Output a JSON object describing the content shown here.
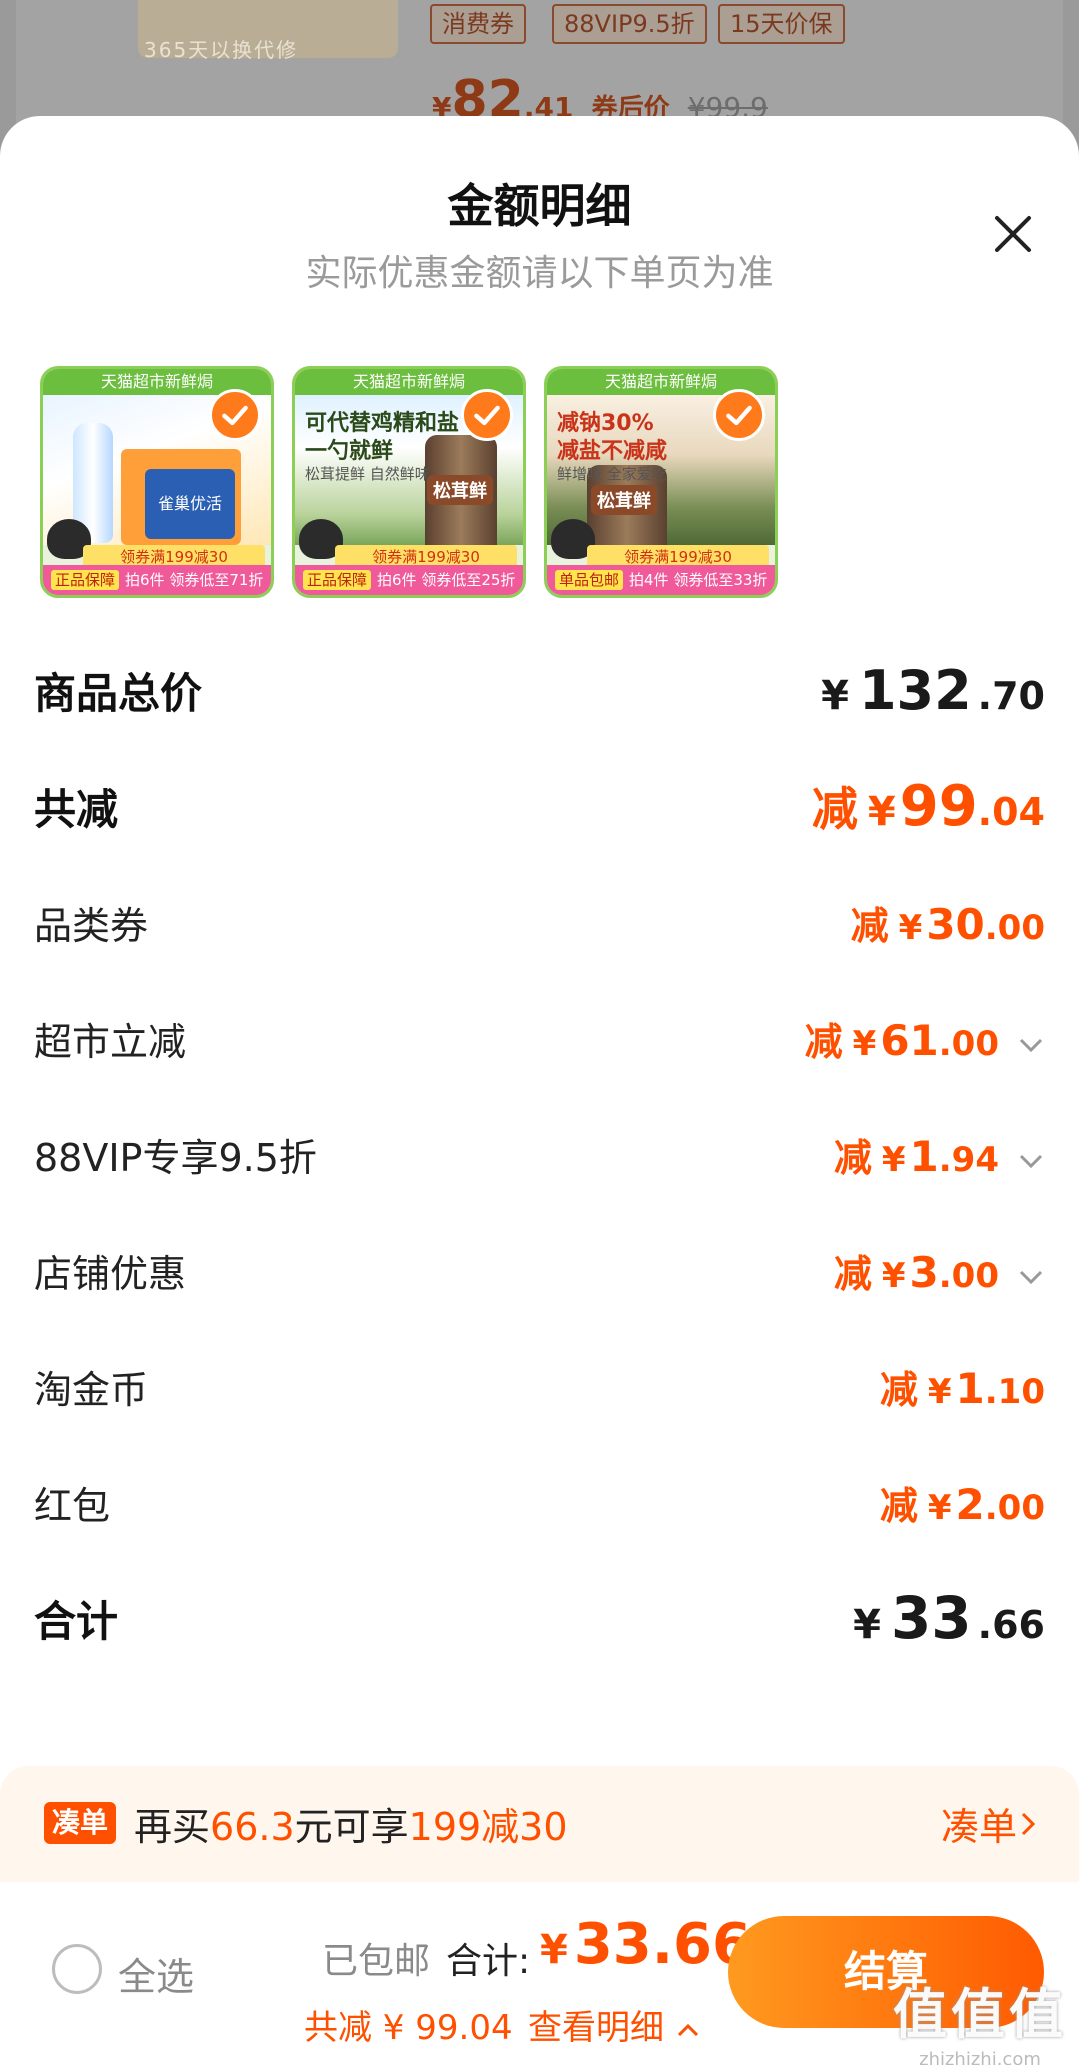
{
  "background": {
    "thumb_text": "365天以换代修",
    "tags": [
      "消费券",
      "88VIP9.5折",
      "15天价保"
    ],
    "price_currency": "¥",
    "price_int": "82",
    "price_dec": ".41",
    "price_after_label": "券后价",
    "price_orig": "¥99.9"
  },
  "sheet": {
    "title": "金额明细",
    "subtitle": "实际优惠金额请以下单页为准",
    "close_icon": "close-icon"
  },
  "products": [
    {
      "top": "天猫超市新鲜焗",
      "coupon": "领券满199减30",
      "badge": "正品保障",
      "bottom": "拍6件 领券低至71折",
      "text1": "",
      "text2": "",
      "brand": "雀巢优活"
    },
    {
      "top": "天猫超市新鲜焗",
      "coupon": "领券满199减30",
      "badge": "正品保障",
      "bottom": "拍6件 领券低至25折",
      "text1": "可代替鸡精和盐",
      "text2": "一勺就鲜",
      "text3": "松茸提鲜 自然鲜味",
      "brand": "松茸鲜"
    },
    {
      "top": "天猫超市新鲜焗",
      "coupon": "领券满199减30",
      "badge": "单品包邮",
      "bottom": "拍4件 领券低至33折",
      "text1": "减钠30%",
      "text2": "减盐不减咸",
      "text3": "鲜增味 全家爱吃",
      "brand": "松茸鲜"
    }
  ],
  "rows": {
    "goods_total": {
      "label": "商品总价",
      "cur": "¥",
      "int": "132",
      "dec": ".70"
    },
    "total_discount": {
      "label": "共减",
      "prefix": "减",
      "cur": "¥",
      "int": "99",
      "dec": ".04"
    },
    "category_coupon": {
      "label": "品类券",
      "prefix": "减",
      "cur": "¥",
      "int": "30",
      "dec": ".00"
    },
    "supermarket_off": {
      "label": "超市立减",
      "prefix": "减",
      "cur": "¥",
      "int": "61",
      "dec": ".00"
    },
    "vip_discount": {
      "label": "88VIP专享9.5折",
      "prefix": "减",
      "cur": "¥",
      "int": "1",
      "dec": ".94"
    },
    "shop_discount": {
      "label": "店铺优惠",
      "prefix": "减",
      "cur": "¥",
      "int": "3",
      "dec": ".00"
    },
    "tao_coin": {
      "label": "淘金币",
      "prefix": "减",
      "cur": "¥",
      "int": "1",
      "dec": ".10"
    },
    "red_packet": {
      "label": "红包",
      "prefix": "减",
      "cur": "¥",
      "int": "2",
      "dec": ".00"
    },
    "sum": {
      "label": "合计",
      "cur": "¥",
      "int": "33",
      "dec": ".66"
    }
  },
  "promo": {
    "badge": "凑单",
    "text_a": "再买",
    "text_amt": "66.3",
    "text_b": "元可享",
    "text_deal": "199减30",
    "link": "凑单"
  },
  "bottom": {
    "select_all": "全选",
    "shipping": "已包邮",
    "total_label": "合计:",
    "total_cur": "¥",
    "total_value": "33.66",
    "saved": "共减 ¥ 99.04",
    "detail_link": "查看明细",
    "checkout": "结算"
  },
  "watermark": {
    "main": "值值值",
    "sub": "zhizhizhi.com"
  },
  "colors": {
    "accent": "#ff5000",
    "checkout_start": "#ff9a1f",
    "checkout_end": "#ff5a00"
  }
}
